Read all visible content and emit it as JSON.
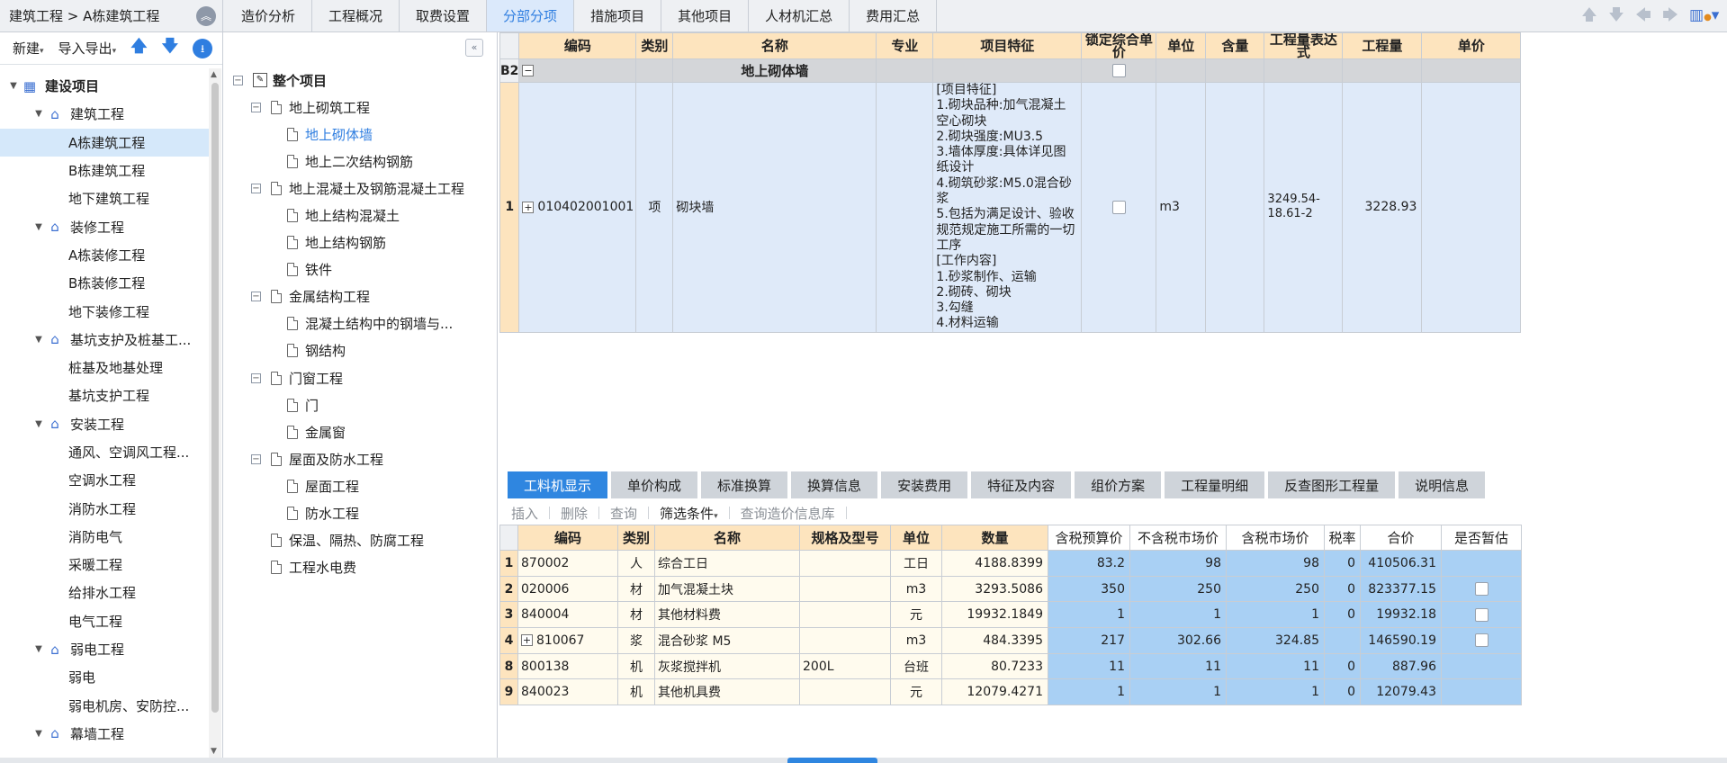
{
  "breadcrumb": "建筑工程 > A栋建筑工程",
  "tabs": [
    {
      "label": "造价分析",
      "active": false
    },
    {
      "label": "工程概况",
      "active": false
    },
    {
      "label": "取费设置",
      "active": false
    },
    {
      "label": "分部分项",
      "active": true
    },
    {
      "label": "措施项目",
      "active": false
    },
    {
      "label": "其他项目",
      "active": false
    },
    {
      "label": "人材机汇总",
      "active": false
    },
    {
      "label": "费用汇总",
      "active": false
    }
  ],
  "left_toolbar": {
    "new": "新建",
    "import_export": "导入导出"
  },
  "project_tree": [
    {
      "label": "建设项目",
      "level": 0,
      "icon": "building-icon",
      "expanded": true,
      "bold": true
    },
    {
      "label": "建筑工程",
      "level": 1,
      "icon": "house-icon",
      "expanded": true
    },
    {
      "label": "A栋建筑工程",
      "level": 2,
      "selected": true
    },
    {
      "label": "B栋建筑工程",
      "level": 2
    },
    {
      "label": "地下建筑工程",
      "level": 2
    },
    {
      "label": "装修工程",
      "level": 1,
      "icon": "house-icon",
      "expanded": true
    },
    {
      "label": "A栋装修工程",
      "level": 2
    },
    {
      "label": "B栋装修工程",
      "level": 2
    },
    {
      "label": "地下装修工程",
      "level": 2
    },
    {
      "label": "基坑支护及桩基工...",
      "level": 1,
      "icon": "house-icon",
      "expanded": true
    },
    {
      "label": "桩基及地基处理",
      "level": 2
    },
    {
      "label": "基坑支护工程",
      "level": 2
    },
    {
      "label": "安装工程",
      "level": 1,
      "icon": "house-icon",
      "expanded": true
    },
    {
      "label": "通风、空调风工程...",
      "level": 2
    },
    {
      "label": "空调水工程",
      "level": 2
    },
    {
      "label": "消防水工程",
      "level": 2
    },
    {
      "label": "消防电气",
      "level": 2
    },
    {
      "label": "采暖工程",
      "level": 2
    },
    {
      "label": "给排水工程",
      "level": 2
    },
    {
      "label": "电气工程",
      "level": 2
    },
    {
      "label": "弱电工程",
      "level": 1,
      "icon": "house-icon",
      "expanded": true
    },
    {
      "label": "弱电",
      "level": 2
    },
    {
      "label": "弱电机房、安防控...",
      "level": 2
    },
    {
      "label": "幕墙工程",
      "level": 1,
      "icon": "house-icon",
      "expanded": true
    }
  ],
  "section_tree": [
    {
      "label": "整个项目",
      "level": 0,
      "box": "minus",
      "root": true
    },
    {
      "label": "地上砌筑工程",
      "level": 1,
      "box": "minus"
    },
    {
      "label": "地上砌体墙",
      "level": 2,
      "selected": true
    },
    {
      "label": "地上二次结构钢筋",
      "level": 2
    },
    {
      "label": "地上混凝土及钢筋混凝土工程",
      "level": 1,
      "box": "minus"
    },
    {
      "label": "地上结构混凝土",
      "level": 2
    },
    {
      "label": "地上结构钢筋",
      "level": 2
    },
    {
      "label": "铁件",
      "level": 2
    },
    {
      "label": "金属结构工程",
      "level": 1,
      "box": "minus"
    },
    {
      "label": "混凝土结构中的钢墙与...",
      "level": 2
    },
    {
      "label": "钢结构",
      "level": 2
    },
    {
      "label": "门窗工程",
      "level": 1,
      "box": "minus"
    },
    {
      "label": "门",
      "level": 2
    },
    {
      "label": "金属窗",
      "level": 2
    },
    {
      "label": "屋面及防水工程",
      "level": 1,
      "box": "minus"
    },
    {
      "label": "屋面工程",
      "level": 2
    },
    {
      "label": "防水工程",
      "level": 2
    },
    {
      "label": "保温、隔热、防腐工程",
      "level": 1
    },
    {
      "label": "工程水电费",
      "level": 1
    }
  ],
  "upper_grid": {
    "headers": [
      "编码",
      "类别",
      "名称",
      "专业",
      "项目特征",
      "锁定综合单价",
      "单位",
      "含量",
      "工程量表达式",
      "工程量",
      "单价"
    ],
    "group_row": {
      "num": "B2",
      "name": "地上砌体墙"
    },
    "data_row": {
      "num": "1",
      "code": "010402001001",
      "category": "项",
      "name": "砌块墙",
      "feature": "[项目特征]\n1.砌块品种:加气混凝土空心砌块\n2.砌块强度:MU3.5\n3.墙体厚度:具体详见图纸设计\n4.砌筑砂浆:M5.0混合砂浆\n5.包括为满足设计、验收规范规定施工所需的一切工序\n[工作内容]\n1.砂浆制作、运输\n2.砌砖、砌块\n3.勾缝\n4.材料运输",
      "unit": "m3",
      "expression": "3249.54-18.61-2",
      "quantity": "3228.93"
    }
  },
  "bottom_tabs": [
    {
      "label": "工料机显示",
      "active": true
    },
    {
      "label": "单价构成",
      "active": false
    },
    {
      "label": "标准换算",
      "active": false
    },
    {
      "label": "换算信息",
      "active": false
    },
    {
      "label": "安装费用",
      "active": false
    },
    {
      "label": "特征及内容",
      "active": false
    },
    {
      "label": "组价方案",
      "active": false
    },
    {
      "label": "工程量明细",
      "active": false
    },
    {
      "label": "反查图形工程量",
      "active": false
    },
    {
      "label": "说明信息",
      "active": false
    }
  ],
  "bottom_tools": {
    "insert": "插入",
    "delete": "删除",
    "query": "查询",
    "filter": "筛选条件",
    "query_price": "查询造价信息库"
  },
  "lower_grid": {
    "headers": [
      "编码",
      "类别",
      "名称",
      "规格及型号",
      "单位",
      "数量",
      "含税预算价",
      "不含税市场价",
      "含税市场价",
      "税率",
      "合价",
      "是否暂估"
    ],
    "rows": [
      {
        "num": "1",
        "code": "870002",
        "cat": "人",
        "name": "综合工日",
        "spec": "",
        "unit": "工日",
        "qty": "4188.8399",
        "tax_budget": "83.2",
        "notax_market": "98",
        "tax_market": "98",
        "rate": "0",
        "total": "410506.31",
        "est": false,
        "expand": false
      },
      {
        "num": "2",
        "code": "020006",
        "cat": "材",
        "name": "加气混凝土块",
        "spec": "",
        "unit": "m3",
        "qty": "3293.5086",
        "tax_budget": "350",
        "notax_market": "250",
        "tax_market": "250",
        "rate": "0",
        "total": "823377.15",
        "est": true,
        "expand": false
      },
      {
        "num": "3",
        "code": "840004",
        "cat": "材",
        "name": "其他材料费",
        "spec": "",
        "unit": "元",
        "qty": "19932.1849",
        "tax_budget": "1",
        "notax_market": "1",
        "tax_market": "1",
        "rate": "0",
        "total": "19932.18",
        "est": true,
        "expand": false
      },
      {
        "num": "4",
        "code": "810067",
        "cat": "浆",
        "name": "混合砂浆 M5",
        "spec": "",
        "unit": "m3",
        "qty": "484.3395",
        "tax_budget": "217",
        "notax_market": "302.66",
        "tax_market": "324.85",
        "rate": "",
        "total": "146590.19",
        "est": true,
        "expand": true
      },
      {
        "num": "8",
        "code": "800138",
        "cat": "机",
        "name": "灰浆搅拌机",
        "spec": "200L",
        "unit": "台班",
        "qty": "80.7233",
        "tax_budget": "11",
        "notax_market": "11",
        "tax_market": "11",
        "rate": "0",
        "total": "887.96",
        "est": false,
        "expand": false
      },
      {
        "num": "9",
        "code": "840023",
        "cat": "机",
        "name": "其他机具费",
        "spec": "",
        "unit": "元",
        "qty": "12079.4271",
        "tax_budget": "1",
        "notax_market": "1",
        "tax_market": "1",
        "rate": "0",
        "total": "12079.43",
        "est": false,
        "expand": false
      }
    ]
  },
  "colors": {
    "accent": "#2f86e0",
    "header_bg": "#fde4be",
    "selected_row": "#dfeaf9",
    "price_cells": "#a9d0f4"
  }
}
